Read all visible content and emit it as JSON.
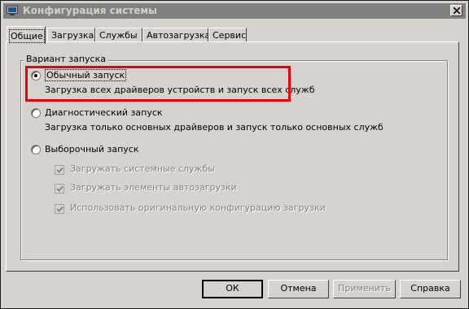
{
  "window": {
    "title": "Конфигурация системы",
    "icon": "system-config-icon",
    "close_icon": "close-icon"
  },
  "tabs": [
    {
      "label": "Общие",
      "active": true
    },
    {
      "label": "Загрузка",
      "active": false
    },
    {
      "label": "Службы",
      "active": false
    },
    {
      "label": "Автозагрузка",
      "active": false
    },
    {
      "label": "Сервис",
      "active": false
    }
  ],
  "startup_group": {
    "legend": "Вариант запуска",
    "options": [
      {
        "label": "Обычный запуск",
        "description": "Загрузка всех драйверов устройств и запуск всех служб",
        "selected": true
      },
      {
        "label": "Диагностический запуск",
        "description": "Загрузка только основных драйверов и запуск только основных служб",
        "selected": false
      },
      {
        "label": "Выборочный запуск",
        "selected": false
      }
    ],
    "selective_checkboxes": [
      {
        "label": "Загружать системные службы",
        "checked": true,
        "enabled": false
      },
      {
        "label": "Загружать элементы автозагрузки",
        "checked": true,
        "enabled": false
      },
      {
        "label": "Использовать оригинальную конфигурацию загрузки",
        "checked": true,
        "enabled": false
      }
    ]
  },
  "buttons": {
    "ok": "ОК",
    "cancel": "Отмена",
    "apply": "Применить",
    "help": "Справка"
  },
  "colors": {
    "dialog_bg": "#d6d3ce",
    "titlebar_inactive": "#808080",
    "highlight_box": "#e8000c"
  }
}
